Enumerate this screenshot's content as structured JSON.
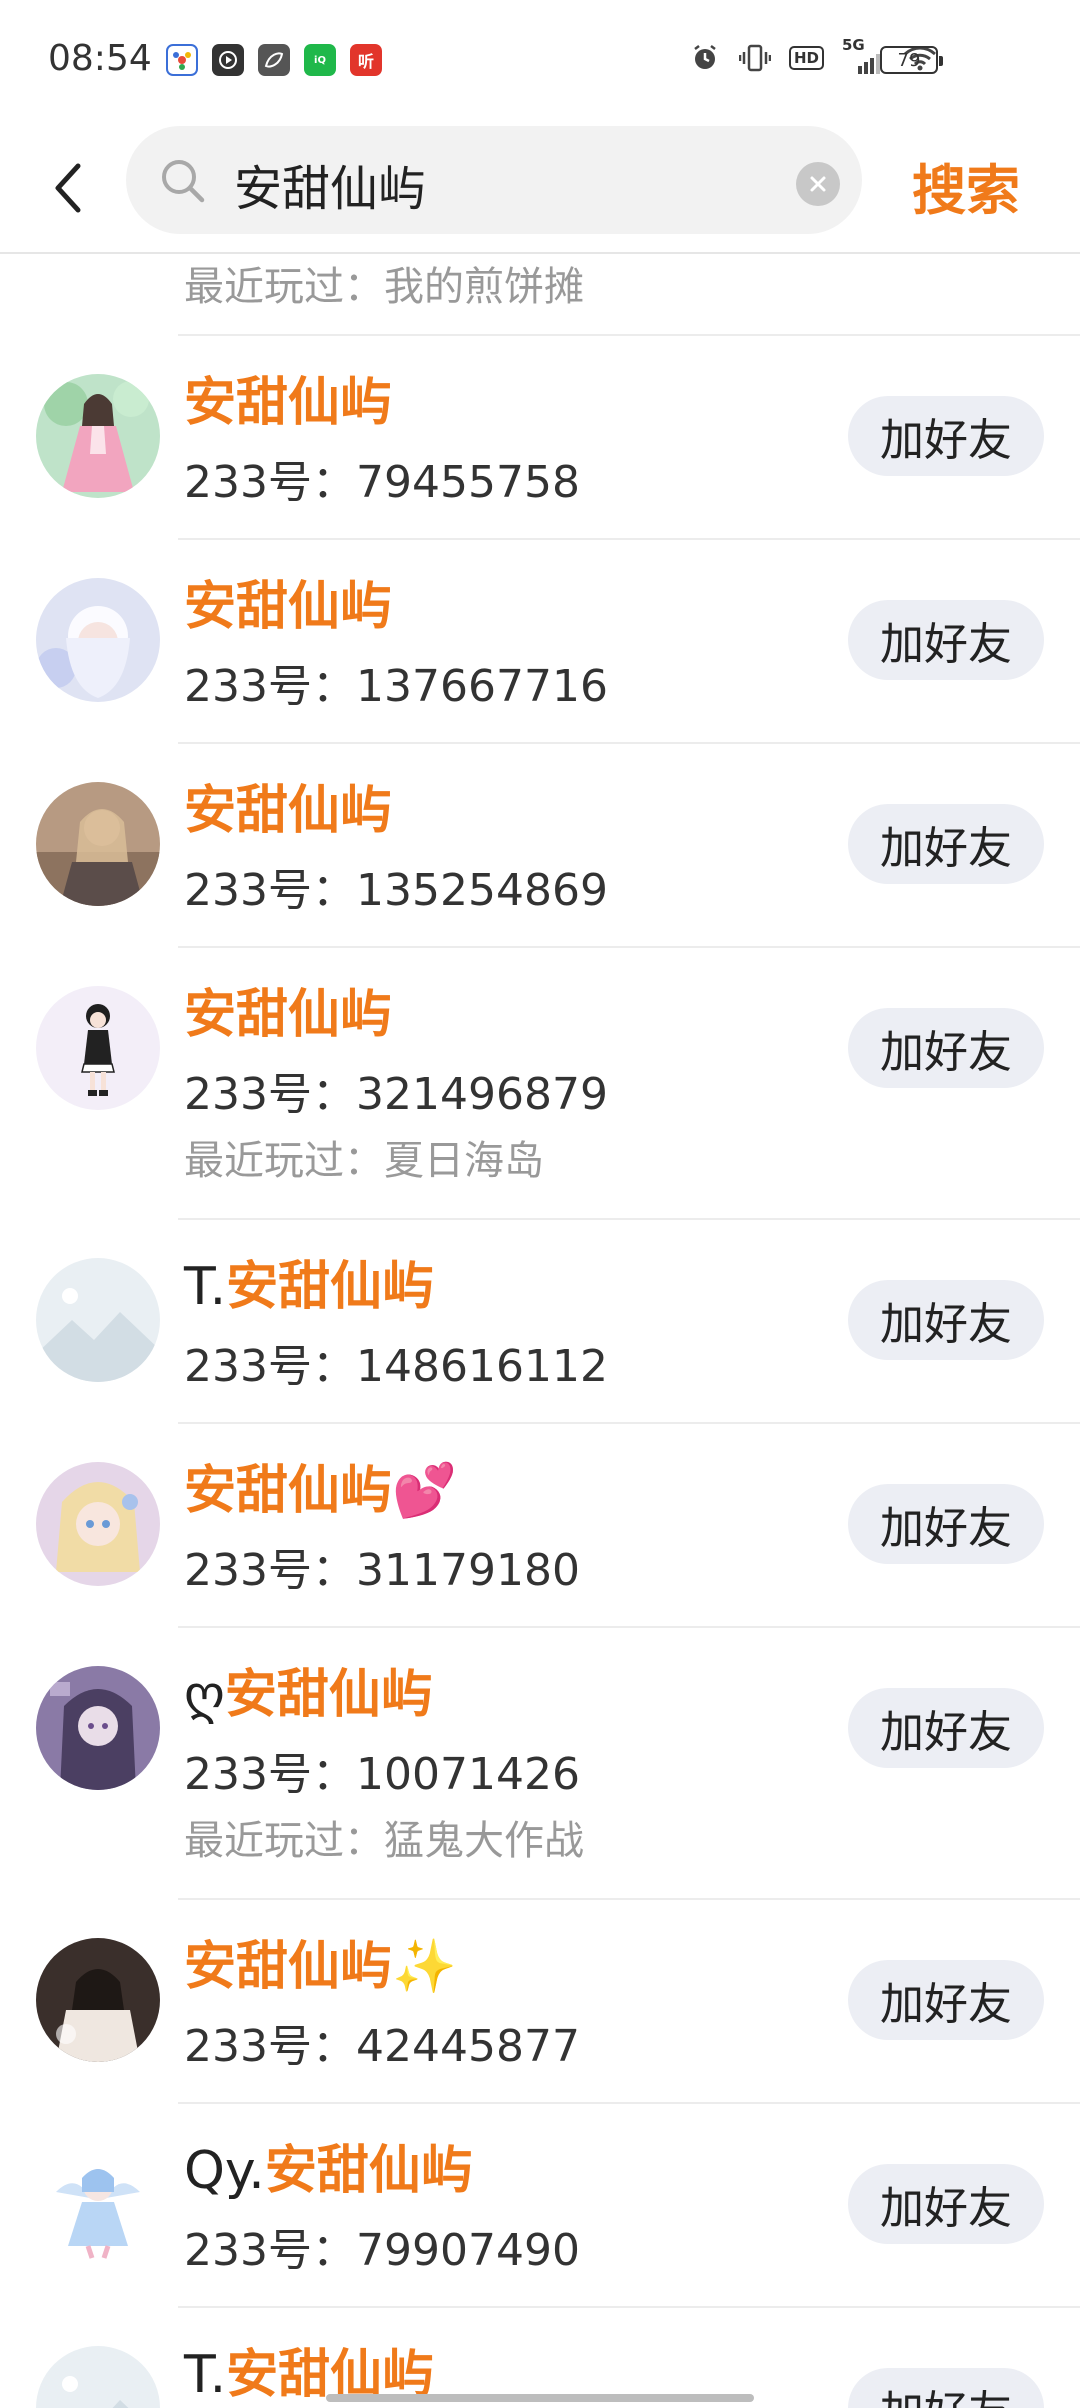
{
  "status_bar": {
    "time": "08:54",
    "network": "5G",
    "hd_label": "HD",
    "battery": "79",
    "app_icons": [
      "pinwheel-icon",
      "play-icon",
      "leaf-icon",
      "iqiyi-icon",
      "ting-icon"
    ],
    "icons": [
      "alarm-icon",
      "vibrate-icon",
      "signal-icon",
      "wifi-icon"
    ]
  },
  "search": {
    "query": "安甜仙屿",
    "submit_label": "搜索",
    "icons": [
      "back-icon",
      "search-icon",
      "clear-icon"
    ]
  },
  "results": {
    "partial_top_recent": "最近玩过：我的煎饼摊",
    "add_label": "加好友",
    "uid_prefix": "233号：",
    "recent_prefix": "最近玩过：",
    "accent_color": "#f07a1a",
    "items": [
      {
        "prefix": "",
        "hit": "安甜仙屿",
        "suffix": "",
        "uid": "79455758",
        "recent": "",
        "avatar": "girl-pink-dress-avatar"
      },
      {
        "prefix": "",
        "hit": "安甜仙屿",
        "suffix": "",
        "uid": "137667716",
        "recent": "",
        "avatar": "anime-white-hair-avatar"
      },
      {
        "prefix": "",
        "hit": "安甜仙屿",
        "suffix": "",
        "uid": "135254869",
        "recent": "",
        "avatar": "photo-girl-avatar"
      },
      {
        "prefix": "",
        "hit": "安甜仙屿",
        "suffix": "",
        "uid": "321496879",
        "recent": "夏日海岛",
        "avatar": "chibi-girl-avatar"
      },
      {
        "prefix": "T.",
        "hit": "安甜仙屿",
        "suffix": "",
        "uid": "148616112",
        "recent": "",
        "avatar": "placeholder-avatar"
      },
      {
        "prefix": "",
        "hit": "安甜仙屿",
        "suffix": "💕",
        "uid": "31179180",
        "recent": "",
        "avatar": "anime-blonde-avatar"
      },
      {
        "prefix": "ღ",
        "hit": "安甜仙屿",
        "suffix": "",
        "uid": "10071426",
        "recent": "猛鬼大作战",
        "avatar": "purple-anime-avatar"
      },
      {
        "prefix": "",
        "hit": "安甜仙屿",
        "suffix": "✨",
        "uid": "42445877",
        "recent": "",
        "avatar": "dark-photo-avatar"
      },
      {
        "prefix": "Qy.",
        "hit": "安甜仙屿",
        "suffix": "",
        "uid": "79907490",
        "recent": "",
        "avatar": "blue-angel-avatar"
      },
      {
        "prefix": "T.",
        "hit": "安甜仙屿",
        "suffix": "",
        "uid": "",
        "recent": "",
        "avatar": "placeholder-avatar"
      }
    ]
  }
}
